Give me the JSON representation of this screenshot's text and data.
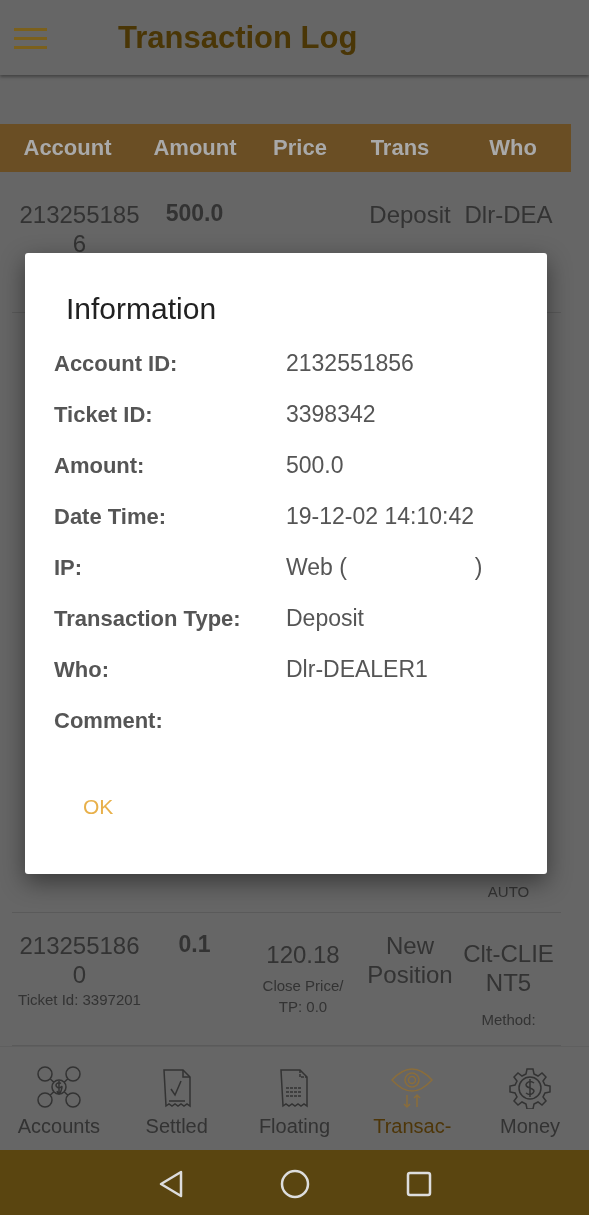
{
  "header": {
    "title": "Transaction Log"
  },
  "table": {
    "columns": [
      "Account",
      "Amount",
      "Price",
      "Trans",
      "Who"
    ],
    "rows": [
      {
        "kind": "top",
        "account": "2132551856",
        "amount": "500.0",
        "trans": "Deposit",
        "who": "Dlr-DEA"
      },
      {
        "kind": "under",
        "who_note": "AUTO"
      },
      {
        "kind": "bottom",
        "account": "2132551860",
        "account_note": "Ticket Id: 3397201",
        "amount": "0.1",
        "price": "120.18",
        "price_note": "Close Price/ TP: 0.0",
        "trans": "New Position",
        "who": "Clt-CLIENT5",
        "who_note": "Method:"
      }
    ]
  },
  "dialog": {
    "title": "Information",
    "fields": [
      {
        "label": "Account ID:",
        "value": "2132551856"
      },
      {
        "label": "Ticket ID:",
        "value": "3398342"
      },
      {
        "label": "Amount:",
        "value": "500.0"
      },
      {
        "label": "Date Time:",
        "value": "19-12-02 14:10:42"
      },
      {
        "label": "IP:",
        "value": "Web (                    )"
      },
      {
        "label": "Transaction Type:",
        "value": "Deposit"
      },
      {
        "label": "Who:",
        "value": "Dlr-DEALER1"
      },
      {
        "label": "Comment:"
      }
    ],
    "button": "OK"
  },
  "bottom_nav": [
    {
      "label": "Accounts",
      "selected": false
    },
    {
      "label": "Settled",
      "selected": false
    },
    {
      "label": "Floating",
      "selected": false
    },
    {
      "label": "Transac-",
      "selected": true
    },
    {
      "label": "Money",
      "selected": false
    }
  ]
}
